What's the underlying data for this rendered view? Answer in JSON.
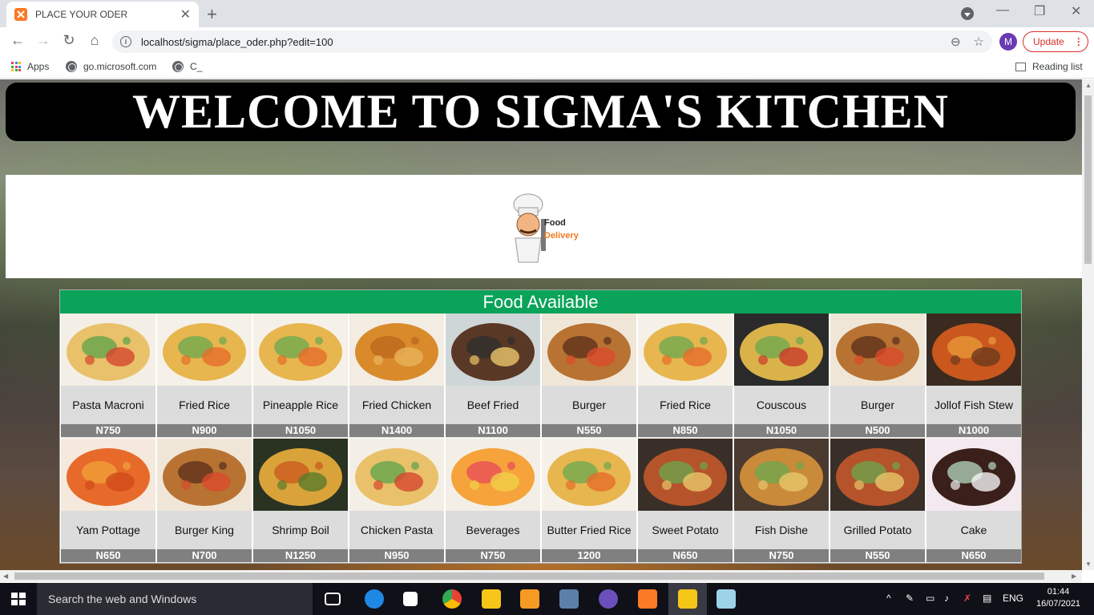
{
  "browser": {
    "tab_title": "PLACE YOUR ODER",
    "new_tab": "+",
    "url": "localhost/sigma/place_oder.php?edit=100",
    "profile_initial": "M",
    "update_label": "Update"
  },
  "bookmarks": {
    "apps": "Apps",
    "item1": "go.microsoft.com",
    "item2": "C_",
    "reading_list": "Reading list"
  },
  "page": {
    "banner_title": "WELCOME TO SIGMA'S KITCHEN",
    "logo_text_1": "Food",
    "logo_text_2": "Delivery",
    "panel_title": "Food Available"
  },
  "foods": [
    {
      "name": "Pasta Macroni",
      "price": "N750",
      "icon": "pasta-image"
    },
    {
      "name": "Fried Rice",
      "price": "N900",
      "icon": "rice-image"
    },
    {
      "name": "Pineapple Rice",
      "price": "N1050",
      "icon": "rice-image"
    },
    {
      "name": "Fried Chicken",
      "price": "N1400",
      "icon": "chicken-image"
    },
    {
      "name": "Beef Fried",
      "price": "N1100",
      "icon": "beef-image"
    },
    {
      "name": "Burger",
      "price": "N550",
      "icon": "burger-image"
    },
    {
      "name": "Fried Rice",
      "price": "N850",
      "icon": "rice-image"
    },
    {
      "name": "Couscous",
      "price": "N1050",
      "icon": "couscous-image"
    },
    {
      "name": "Burger",
      "price": "N500",
      "icon": "burger-image"
    },
    {
      "name": "Jollof Fish Stew",
      "price": "N1000",
      "icon": "fish-stew-image"
    },
    {
      "name": "Yam Pottage",
      "price": "N650",
      "icon": "yam-image"
    },
    {
      "name": "Burger King",
      "price": "N700",
      "icon": "burger-image"
    },
    {
      "name": "Shrimp Boil",
      "price": "N1250",
      "icon": "shrimp-image"
    },
    {
      "name": "Chicken Pasta",
      "price": "N950",
      "icon": "pasta-image"
    },
    {
      "name": "Beverages",
      "price": "N750",
      "icon": "drinks-image"
    },
    {
      "name": "Butter Fried Rice",
      "price": "1200",
      "icon": "rice-image"
    },
    {
      "name": "Sweet Potato",
      "price": "N650",
      "icon": "potato-image"
    },
    {
      "name": "Fish Dishe",
      "price": "N750",
      "icon": "fish-image"
    },
    {
      "name": "Grilled Potato",
      "price": "N550",
      "icon": "potato-image"
    },
    {
      "name": "Cake",
      "price": "N650",
      "icon": "cake-image"
    }
  ],
  "taskbar": {
    "search_placeholder": "Search the web and Windows",
    "language": "ENG",
    "time": "01:44",
    "date": "16/07/2021"
  },
  "colors": {
    "panel_header": "#0aa35a",
    "price_bar": "#808080",
    "update_red": "#d93025"
  }
}
